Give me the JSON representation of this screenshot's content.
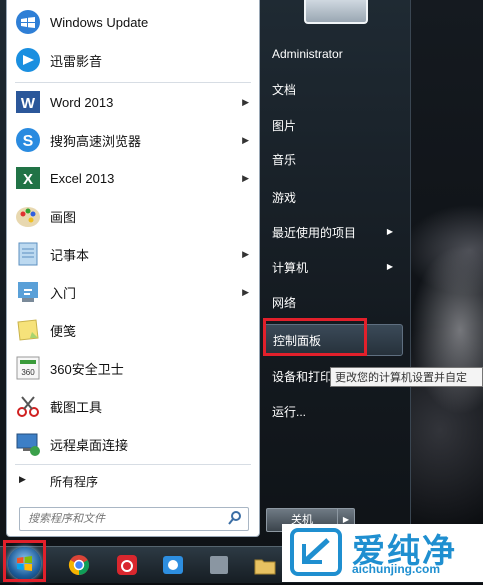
{
  "programs": [
    {
      "label": "Windows Update",
      "icon": "windows-update-icon",
      "arrow": false
    },
    {
      "label": "迅雷影音",
      "icon": "xunlei-player-icon",
      "arrow": false
    },
    {
      "label": "Word 2013",
      "icon": "word-icon",
      "arrow": true
    },
    {
      "label": "搜狗高速浏览器",
      "icon": "sogou-browser-icon",
      "arrow": true
    },
    {
      "label": "Excel 2013",
      "icon": "excel-icon",
      "arrow": true
    },
    {
      "label": "画图",
      "icon": "paint-icon",
      "arrow": false
    },
    {
      "label": "记事本",
      "icon": "notepad-icon",
      "arrow": true
    },
    {
      "label": "入门",
      "icon": "getting-started-icon",
      "arrow": true
    },
    {
      "label": "便笺",
      "icon": "sticky-notes-icon",
      "arrow": false
    },
    {
      "label": "360安全卫士",
      "icon": "360-safe-icon",
      "arrow": false
    },
    {
      "label": "截图工具",
      "icon": "snipping-tool-icon",
      "arrow": false
    },
    {
      "label": "远程桌面连接",
      "icon": "remote-desktop-icon",
      "arrow": false
    }
  ],
  "all_programs_label": "所有程序",
  "search": {
    "placeholder": "搜索程序和文件"
  },
  "right_menu": [
    {
      "label": "Administrator",
      "arrow": false
    },
    {
      "label": "文档",
      "arrow": false
    },
    {
      "label": "图片",
      "arrow": false
    },
    {
      "label": "音乐",
      "arrow": false
    },
    {
      "label": "游戏",
      "arrow": false
    },
    {
      "label": "最近使用的项目",
      "arrow": true
    },
    {
      "label": "计算机",
      "arrow": true
    },
    {
      "label": "网络",
      "arrow": false
    },
    {
      "label": "控制面板",
      "arrow": false,
      "highlighted": true
    },
    {
      "label": "设备和打印",
      "arrow": false
    },
    {
      "label": "运行...",
      "arrow": false
    }
  ],
  "tooltip": "更改您的计算机设置并自定",
  "shutdown_label": "关机",
  "taskbar_icons": [
    "chrome-icon",
    "netease-music-icon",
    "qq-browser-icon",
    "file-explorer-icon"
  ],
  "watermark": {
    "title": "爱纯净",
    "url": "aichunjing.com"
  },
  "colors": {
    "highlight_box": "#e2202b",
    "watermark": "#1f8fd0"
  }
}
